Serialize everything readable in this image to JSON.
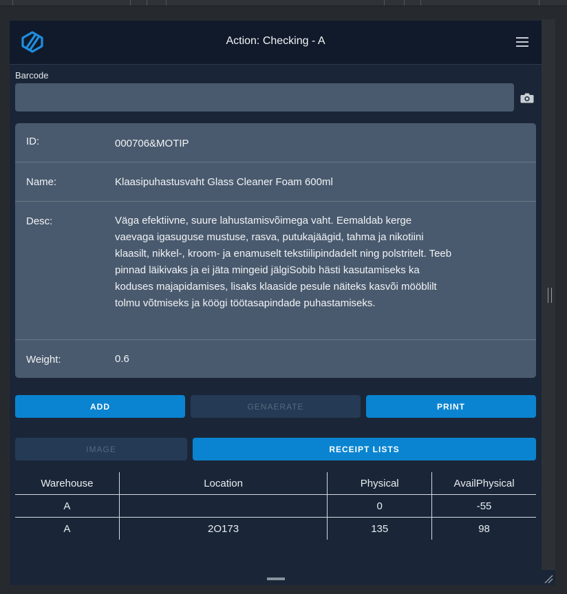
{
  "header": {
    "title": "Action: Checking - A",
    "logo_icon": "brand-logo-icon",
    "menu_icon": "hamburger-menu-icon"
  },
  "barcode": {
    "label": "Barcode",
    "value": "",
    "placeholder": "",
    "camera_icon": "camera-icon"
  },
  "details": {
    "id_label": "ID:",
    "id_value": "000706&MOTIP",
    "name_label": "Name:",
    "name_value": "Klaasipuhastusvaht Glass Cleaner Foam 600ml",
    "desc_label": "Desc:",
    "desc_value": "Väga efektiivne, suure lahustamisvõimega vaht. Eemaldab kerge vaevaga igasuguse mustuse, rasva, putukajäägid, tahma ja nikotiini klaasilt, nikkel-, kroom- ja enamuselt tekstiilipindadelt ning polstritelt. Teeb pinnad läikivaks ja ei jäta mingeid jälgiSobib hästi kasutamiseks ka koduses majapidamises, lisaks klaaside pesule näiteks kasvõi mööblilt tolmu võtmiseks ja köögi töötasapindade puhastamiseks.",
    "weight_label": "Weight:",
    "weight_value": "0.6"
  },
  "actions": {
    "add": "ADD",
    "generate": "GENAERATE",
    "print": "PRINT",
    "image": "IMAGE",
    "receipt_lists": "RECEIPT LISTS"
  },
  "stock_table": {
    "columns": [
      "Warehouse",
      "Location",
      "Physical",
      "AvailPhysical"
    ],
    "rows": [
      [
        "A",
        "",
        "0",
        "-55"
      ],
      [
        "A",
        "2O173",
        "135",
        "98"
      ]
    ]
  },
  "colors": {
    "background": "#1a2637",
    "header": "#111a2b",
    "card": "#4a5a6e",
    "primary": "#0a84d0",
    "disabled": "#253a55"
  }
}
